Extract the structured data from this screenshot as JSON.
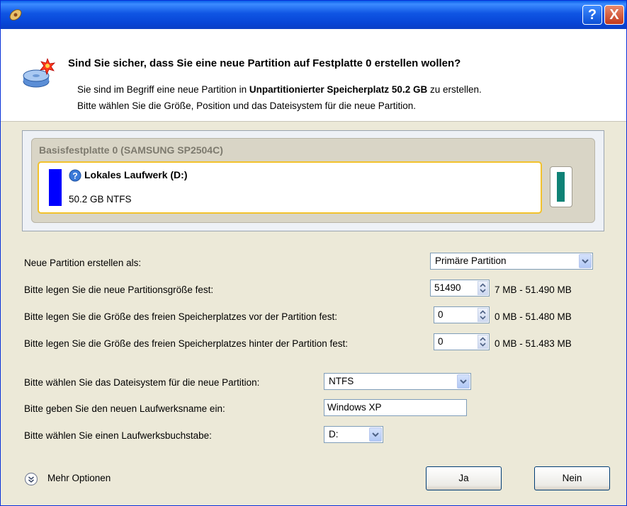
{
  "window": {
    "help_button": "?",
    "close_button": "X"
  },
  "header": {
    "question": "Sind Sie sicher, dass Sie eine neue Partition auf Festplatte 0 erstellen wollen?",
    "desc_line1_prefix": "Sie sind im Begriff eine neue Partition in ",
    "desc_line1_bold": "Unpartitionierter Speicherplatz 50.2 GB",
    "desc_line1_suffix": " zu erstellen.",
    "desc_line2": "Bitte wählen Sie die Größe, Position und das Dateisystem für die neue Partition."
  },
  "disk": {
    "label": "Basisfestplatte 0 (SAMSUNG SP2504C)",
    "partition_name": "Lokales Laufwerk (D:)",
    "partition_info": "50.2 GB NTFS",
    "colors": {
      "partition_bar": "#0000ff",
      "right_bar": "#0f8276",
      "selection_border": "#f2c22c"
    }
  },
  "form": {
    "create_as_label": "Neue Partition erstellen als:",
    "create_as_value": "Primäre Partition",
    "size_label": "Bitte legen Sie die neue Partitionsgröße fest:",
    "size_value": "51490",
    "size_range": "7 MB - 51.490 MB",
    "before_label": "Bitte legen Sie die Größe des freien Speicherplatzes vor der Partition fest:",
    "before_value": "0",
    "before_range": "0 MB - 51.480 MB",
    "after_label": "Bitte legen Sie die Größe des freien Speicherplatzes hinter der Partition fest:",
    "after_value": "0",
    "after_range": "0 MB - 51.483 MB",
    "fs_label": "Bitte wählen Sie das Dateisystem für die neue Partition:",
    "fs_value": "NTFS",
    "name_label": "Bitte geben Sie den neuen Laufwerksname ein:",
    "name_value": "Windows XP",
    "letter_label": "Bitte wählen Sie einen Laufwerksbuchstabe:",
    "letter_value": "D:"
  },
  "footer": {
    "more_options": "Mehr Optionen",
    "yes": "Ja",
    "no": "Nein"
  }
}
